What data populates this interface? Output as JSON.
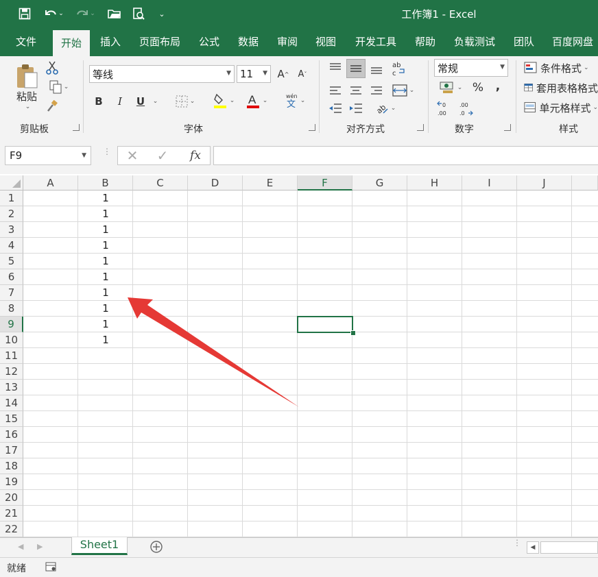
{
  "title_bar": {
    "title": "工作簿1 - Excel"
  },
  "tabs": [
    "文件",
    "开始",
    "插入",
    "页面布局",
    "公式",
    "数据",
    "审阅",
    "视图",
    "开发工具",
    "帮助",
    "负载测试",
    "团队",
    "百度网盘"
  ],
  "active_tab": "开始",
  "ribbon": {
    "clipboard": {
      "paste_label": "粘贴",
      "group_label": "剪贴板"
    },
    "font": {
      "font_name": "等线",
      "font_size": "11",
      "bold": "B",
      "italic": "I",
      "underline": "U",
      "phonetic": "wén\n文",
      "group_label": "字体",
      "fill_color": "#ffff00",
      "font_color": "#ff0000"
    },
    "alignment": {
      "group_label": "对齐方式",
      "wrap_icon": "ab\nc"
    },
    "number": {
      "format": "常规",
      "percent": "%",
      "comma": ",",
      "group_label": "数字"
    },
    "styles": {
      "conditional": "条件格式",
      "table_format": "套用表格格式",
      "cell_styles": "单元格样式",
      "group_label": "样式"
    }
  },
  "formula_bar": {
    "name_box": "F9",
    "fx": "fx",
    "value": ""
  },
  "columns": [
    "A",
    "B",
    "C",
    "D",
    "E",
    "F",
    "G",
    "H",
    "I",
    "J"
  ],
  "selected_column": "F",
  "rows": [
    "1",
    "2",
    "3",
    "4",
    "5",
    "6",
    "7",
    "8",
    "9",
    "10",
    "11",
    "12",
    "13",
    "14",
    "15",
    "16",
    "17",
    "18",
    "19",
    "20",
    "21",
    "22"
  ],
  "selected_row": "9",
  "cells": {
    "B1": "1",
    "B2": "1",
    "B3": "1",
    "B4": "1",
    "B5": "1",
    "B6": "1",
    "B7": "1",
    "B8": "1",
    "B9": "1",
    "B10": "1"
  },
  "sheet_tabs": [
    "Sheet1"
  ],
  "status": {
    "ready": "就绪"
  },
  "colors": {
    "accent": "#217346",
    "annotation_arrow": "#e53935"
  }
}
